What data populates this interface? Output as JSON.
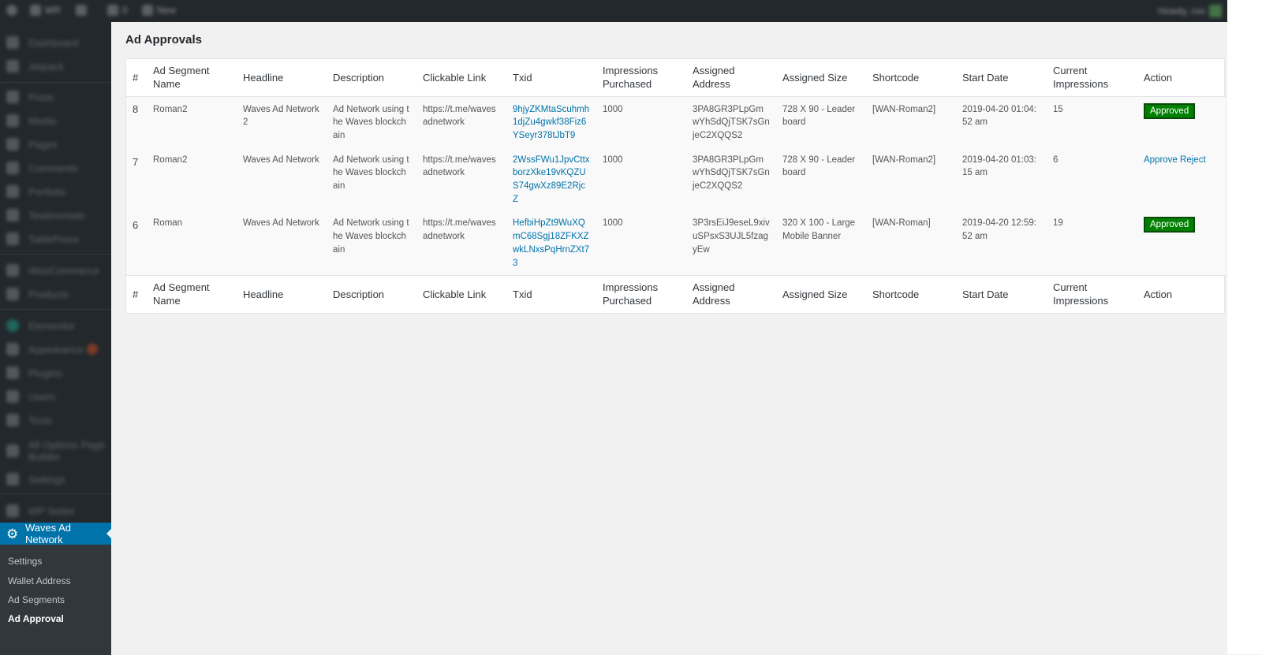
{
  "admin_bar": {
    "site_name": "WR",
    "comments_count": "0",
    "new_label": "New",
    "howdy": "Howdy, roo"
  },
  "sidebar": {
    "items": [
      {
        "label": "Dashboard",
        "icon": "dashboard-icon"
      },
      {
        "label": "Jetpack",
        "icon": "jetpack-icon"
      },
      {
        "label": "Posts",
        "icon": "pin-icon"
      },
      {
        "label": "Media",
        "icon": "media-icon"
      },
      {
        "label": "Pages",
        "icon": "pages-icon"
      },
      {
        "label": "Comments",
        "icon": "comment-icon"
      },
      {
        "label": "Portfolio",
        "icon": "portfolio-icon"
      },
      {
        "label": "Testimonials",
        "icon": "testimonial-icon"
      },
      {
        "label": "TablePress",
        "icon": "table-icon"
      },
      {
        "label": "WooCommerce",
        "icon": "woocommerce-icon"
      },
      {
        "label": "Products",
        "icon": "products-icon"
      },
      {
        "label": "Elementor",
        "icon": "elementor-icon"
      },
      {
        "label": "Appearance",
        "icon": "brush-icon"
      },
      {
        "label": "Plugins",
        "icon": "plugin-icon"
      },
      {
        "label": "Users",
        "icon": "users-icon"
      },
      {
        "label": "Tools",
        "icon": "tools-icon"
      },
      {
        "label": "All Options Page Builder",
        "icon": "builder-icon"
      },
      {
        "label": "Settings",
        "icon": "settings-icon"
      },
      {
        "label": "WP Setter",
        "icon": "setter-icon"
      }
    ],
    "active_menu": "Waves Ad Network",
    "submenu": [
      "Settings",
      "Wallet Address",
      "Ad Segments",
      "Ad Approval"
    ]
  },
  "page": {
    "title": "Ad Approvals"
  },
  "table": {
    "columns": [
      "#",
      "Ad Segment Name",
      "Headline",
      "Description",
      "Clickable Link",
      "Txid",
      "Impressions Purchased",
      "Assigned Address",
      "Assigned Size",
      "Shortcode",
      "Start Date",
      "Current Impressions",
      "Action"
    ],
    "rows": [
      {
        "id": "8",
        "segment": "Roman2",
        "headline": "Waves Ad Network 2",
        "description": "Ad Network using the Waves blockchain",
        "link": "https://t.me/wavesadnetwork",
        "txid": "9hjyZKMtaScuhmh1djZu4gwkf38Fiz6YSeyr378tJbT9",
        "impressions": "1000",
        "address": "3PA8GR3PLpGmwYhSdQjTSK7sGnjeC2XQQS2",
        "size": "728 X 90 - Leaderboard",
        "shortcode": "[WAN-Roman2]",
        "start_date": "2019-04-20 01:04:52 am",
        "current": "15",
        "status": "Approved"
      },
      {
        "id": "7",
        "segment": "Roman2",
        "headline": "Waves Ad Network",
        "description": "Ad Network using the Waves blockchain",
        "link": "https://t.me/wavesadnetwork",
        "txid": "2WssFWu1JpvCttxborzXke19vKQZUS74gwXz89E2RjcZ",
        "impressions": "1000",
        "address": "3PA8GR3PLpGmwYhSdQjTSK7sGnjeC2XQQS2",
        "size": "728 X 90 - Leaderboard",
        "shortcode": "[WAN-Roman2]",
        "start_date": "2019-04-20 01:03:15 am",
        "current": "6",
        "approve_label": "Approve",
        "reject_label": "Reject"
      },
      {
        "id": "6",
        "segment": "Roman",
        "headline": "Waves Ad Network",
        "description": "Ad Network using the Waves blockchain",
        "link": "https://t.me/wavesadnetwork",
        "txid": "HefbiHpZt9WuXQmC68Sgj18ZFKXZwkLNxsPqHrnZXt73",
        "impressions": "1000",
        "address": "3P3rsEiJ9eseL9xivuSPsxS3UJL5fzagyEw",
        "size": "320 X 100 - Large Mobile Banner",
        "shortcode": "[WAN-Roman]",
        "start_date": "2019-04-20 12:59:52 am",
        "current": "19",
        "status": "Approved"
      }
    ]
  },
  "colors": {
    "admin_bar": "#23282d",
    "accent": "#0073aa",
    "approved": "#008000",
    "background": "#f1f1f1"
  }
}
